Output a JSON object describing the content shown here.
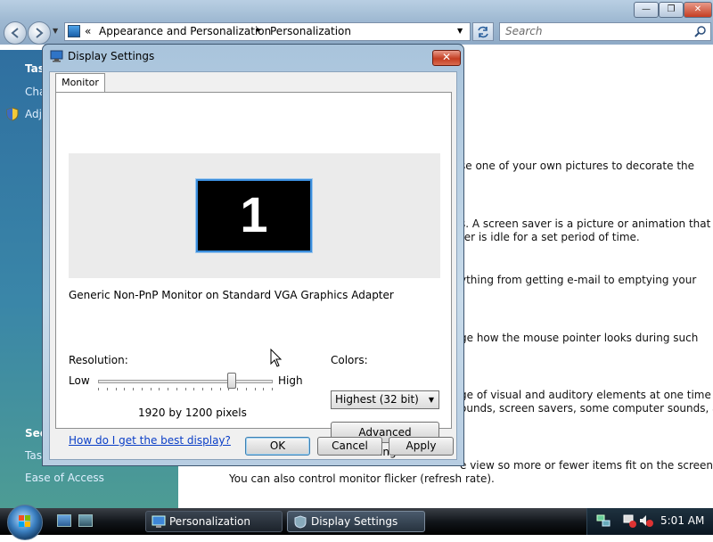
{
  "explorer": {
    "breadcrumb": {
      "back_label": "«",
      "part1": "Appearance and Personalization",
      "separator": "▸",
      "part2": "Personalization"
    },
    "search_placeholder": "Search",
    "window_controls": {
      "minimize": "—",
      "maximize": "❐",
      "close": "✕"
    },
    "left_pane": {
      "tasks_heading": "Tas",
      "task1": "Cha",
      "task2": "Adj",
      "see_also_heading": "See",
      "see_also_item1": "Tas",
      "see_also_item2": "Ease of Access"
    },
    "content_lines": [
      "se one of your own pictures to decorate the",
      "s. A screen saver is a picture or animation that",
      "ter is idle for a set period of time.",
      "ything from getting e-mail to emptying your",
      "ge how the mouse pointer looks during such",
      "ge of visual and auditory elements at one time",
      "ounds, screen savers, some computer sounds, and",
      "e view so more or fewer items fit on the screen.",
      "You can also control monitor flicker (refresh rate)."
    ]
  },
  "dialog": {
    "title": "Display Settings",
    "close_label": "✕",
    "tab_label": "Monitor",
    "monitor_number": "1",
    "monitor_description": "Generic Non-PnP Monitor on Standard VGA Graphics Adapter",
    "resolution": {
      "label": "Resolution:",
      "low_label": "Low",
      "high_label": "High",
      "value_text": "1920 by 1200 pixels",
      "slider_fraction": 0.78
    },
    "colors": {
      "label": "Colors:",
      "selected": "Highest (32 bit)"
    },
    "help_link": "How do I get the best display?",
    "advanced_button": "Advanced Settings...",
    "ok_button": "OK",
    "cancel_button": "Cancel",
    "apply_button": "Apply"
  },
  "taskbar": {
    "tasks": [
      {
        "label": "Personalization"
      },
      {
        "label": "Display Settings"
      }
    ],
    "clock": "5:01 AM"
  }
}
